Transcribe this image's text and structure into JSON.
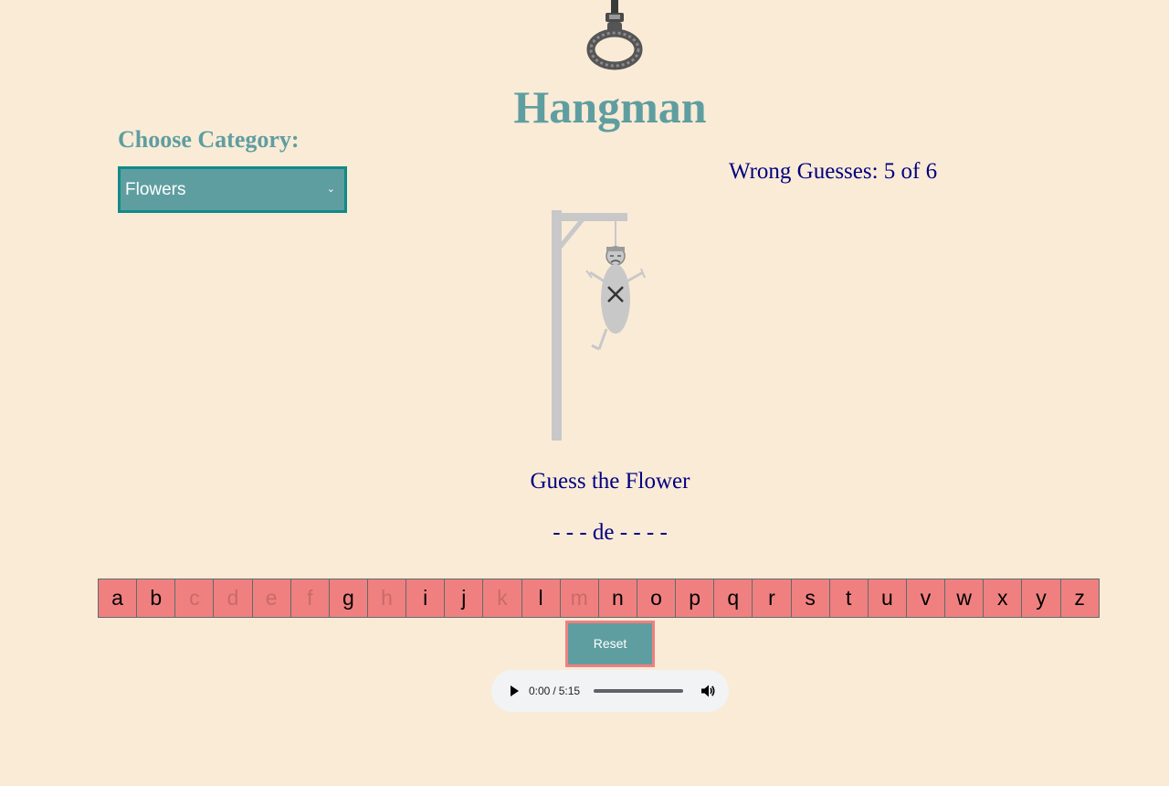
{
  "app": {
    "title": "Hangman"
  },
  "logo": {
    "icon": "noose-icon"
  },
  "category": {
    "label": "Choose Category:",
    "selected": "Flowers"
  },
  "status": {
    "wrong_guesses": "Wrong Guesses: 5 of 6",
    "wrong_count": 5,
    "max_wrong": 6
  },
  "game": {
    "prompt": "Guess the Flower",
    "masked_word": "- - - de - - - -"
  },
  "alphabet": [
    {
      "letter": "a",
      "used": false
    },
    {
      "letter": "b",
      "used": false
    },
    {
      "letter": "c",
      "used": true
    },
    {
      "letter": "d",
      "used": true
    },
    {
      "letter": "e",
      "used": true
    },
    {
      "letter": "f",
      "used": true
    },
    {
      "letter": "g",
      "used": false
    },
    {
      "letter": "h",
      "used": true
    },
    {
      "letter": "i",
      "used": false
    },
    {
      "letter": "j",
      "used": false
    },
    {
      "letter": "k",
      "used": true
    },
    {
      "letter": "l",
      "used": false
    },
    {
      "letter": "m",
      "used": true
    },
    {
      "letter": "n",
      "used": false
    },
    {
      "letter": "o",
      "used": false
    },
    {
      "letter": "p",
      "used": false
    },
    {
      "letter": "q",
      "used": false
    },
    {
      "letter": "r",
      "used": false
    },
    {
      "letter": "s",
      "used": false
    },
    {
      "letter": "t",
      "used": false
    },
    {
      "letter": "u",
      "used": false
    },
    {
      "letter": "v",
      "used": false
    },
    {
      "letter": "w",
      "used": false
    },
    {
      "letter": "x",
      "used": false
    },
    {
      "letter": "y",
      "used": false
    },
    {
      "letter": "z",
      "used": false
    }
  ],
  "controls": {
    "reset_label": "Reset"
  },
  "audio": {
    "current_time": "0:00",
    "separator": "/",
    "duration": "5:15",
    "progress": 0
  },
  "colors": {
    "background": "#faebd7",
    "accent": "#5f9ea0",
    "letter_bg": "#f08080",
    "text_navy": "#000080"
  }
}
